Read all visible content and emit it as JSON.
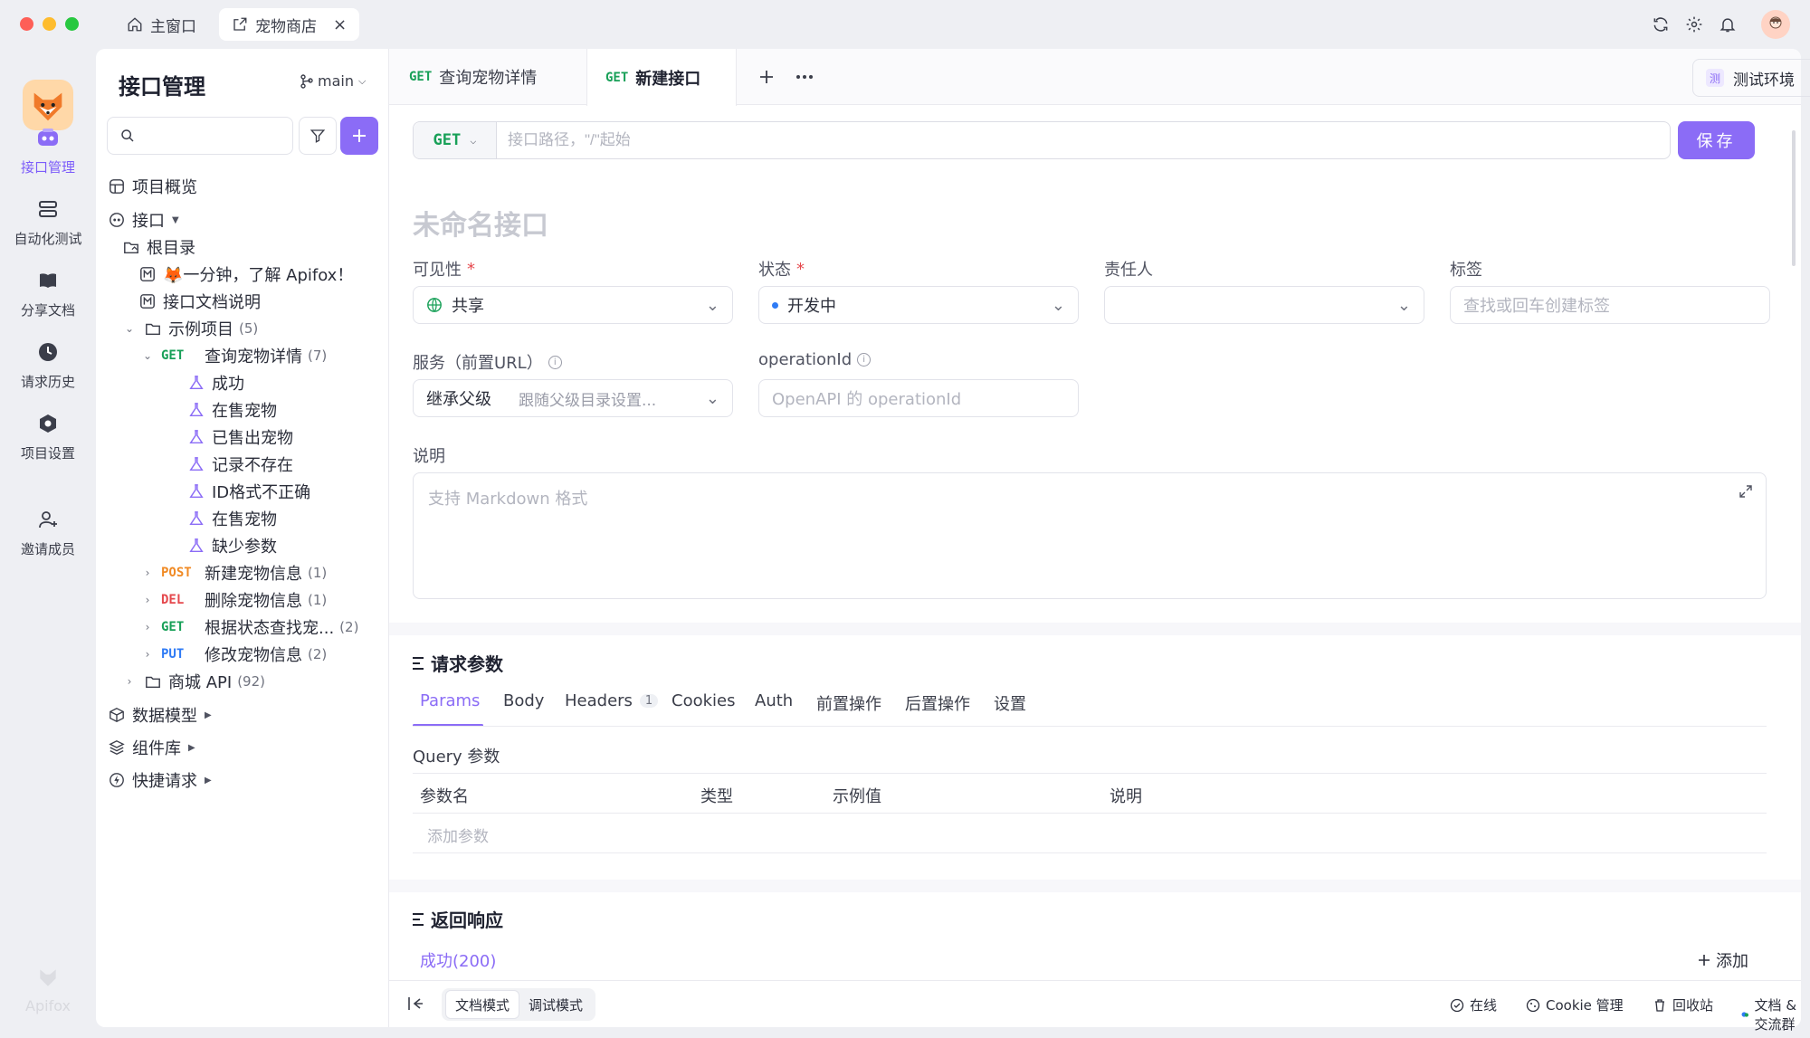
{
  "window": {
    "tabs": [
      {
        "label": "主窗口"
      },
      {
        "label": "宠物商店",
        "close": "×"
      }
    ]
  },
  "rail": {
    "items": [
      {
        "label": "接口管理",
        "icon": "api-icon"
      },
      {
        "label": "自动化测试",
        "icon": "automation-icon"
      },
      {
        "label": "分享文档",
        "icon": "book-icon"
      },
      {
        "label": "请求历史",
        "icon": "clock-icon"
      },
      {
        "label": "项目设置",
        "icon": "gear-icon"
      },
      {
        "label": "邀请成员",
        "icon": "add-user-icon"
      }
    ],
    "brand": "Apifox"
  },
  "sidebar": {
    "title": "接口管理",
    "branch": "main",
    "overview": "项目概览",
    "api_root": "接口",
    "root_dir": "根目录",
    "doc1": "🦊一分钟，了解 Apifox！",
    "doc2": "接口文档说明",
    "example_folder": "示例项目",
    "example_count": "(5)",
    "endpoints": [
      {
        "method": "GET",
        "name": "查询宠物详情",
        "count": "(7)"
      },
      {
        "method": "POST",
        "name": "新建宠物信息",
        "count": "(1)"
      },
      {
        "method": "DEL",
        "name": "删除宠物信息",
        "count": "(1)"
      },
      {
        "method": "GET",
        "name": "根据状态查找宠...",
        "count": "(2)"
      },
      {
        "method": "PUT",
        "name": "修改宠物信息",
        "count": "(2)"
      }
    ],
    "cases": [
      "成功",
      "在售宠物",
      "已售出宠物",
      "记录不存在",
      "ID格式不正确",
      "在售宠物",
      "缺少参数"
    ],
    "mall_folder": "商城 API",
    "mall_count": "(92)",
    "data_model": "数据模型",
    "components": "组件库",
    "quick_request": "快捷请求"
  },
  "editor": {
    "tabs": [
      {
        "method": "GET",
        "label": "查询宠物详情"
      },
      {
        "method": "GET",
        "label": "新建接口"
      }
    ],
    "env_badge": "测",
    "environment": "测试环境",
    "method": "GET",
    "url_placeholder": "接口路径，\"/\"起始",
    "save": "保存",
    "name_placeholder": "未命名接口",
    "fields": {
      "visibility_label": "可见性",
      "visibility_value": "共享",
      "status_label": "状态",
      "status_value": "开发中",
      "owner_label": "责任人",
      "tags_label": "标签",
      "tags_placeholder": "查找或回车创建标签",
      "service_label": "服务（前置URL）",
      "service_value": "继承父级",
      "service_hint": "跟随父级目录设置...",
      "opid_label": "operationId",
      "opid_placeholder": "OpenAPI 的 operationId",
      "desc_label": "说明",
      "desc_placeholder": "支持 Markdown 格式"
    },
    "request": {
      "title": "请求参数",
      "tabs": [
        "Params",
        "Body",
        "Headers",
        "Cookies",
        "Auth",
        "前置操作",
        "后置操作",
        "设置"
      ],
      "headers_count": "1",
      "query_title": "Query 参数",
      "columns": [
        "参数名",
        "类型",
        "示例值",
        "说明"
      ],
      "add_param": "添加参数"
    },
    "response": {
      "title": "返回响应",
      "tab": "成功(200)",
      "add": "添加"
    },
    "bottom": {
      "doc_mode": "文档模式",
      "debug_mode": "调试模式",
      "online": "在线",
      "cookie": "Cookie 管理",
      "trash": "回收站",
      "community": "文档 & 交流群"
    }
  },
  "colors": {
    "accent": "#8b6cf6",
    "get": "#18a058",
    "post": "#f08a24",
    "delete": "#e5484d",
    "put": "#2f7bf5"
  }
}
